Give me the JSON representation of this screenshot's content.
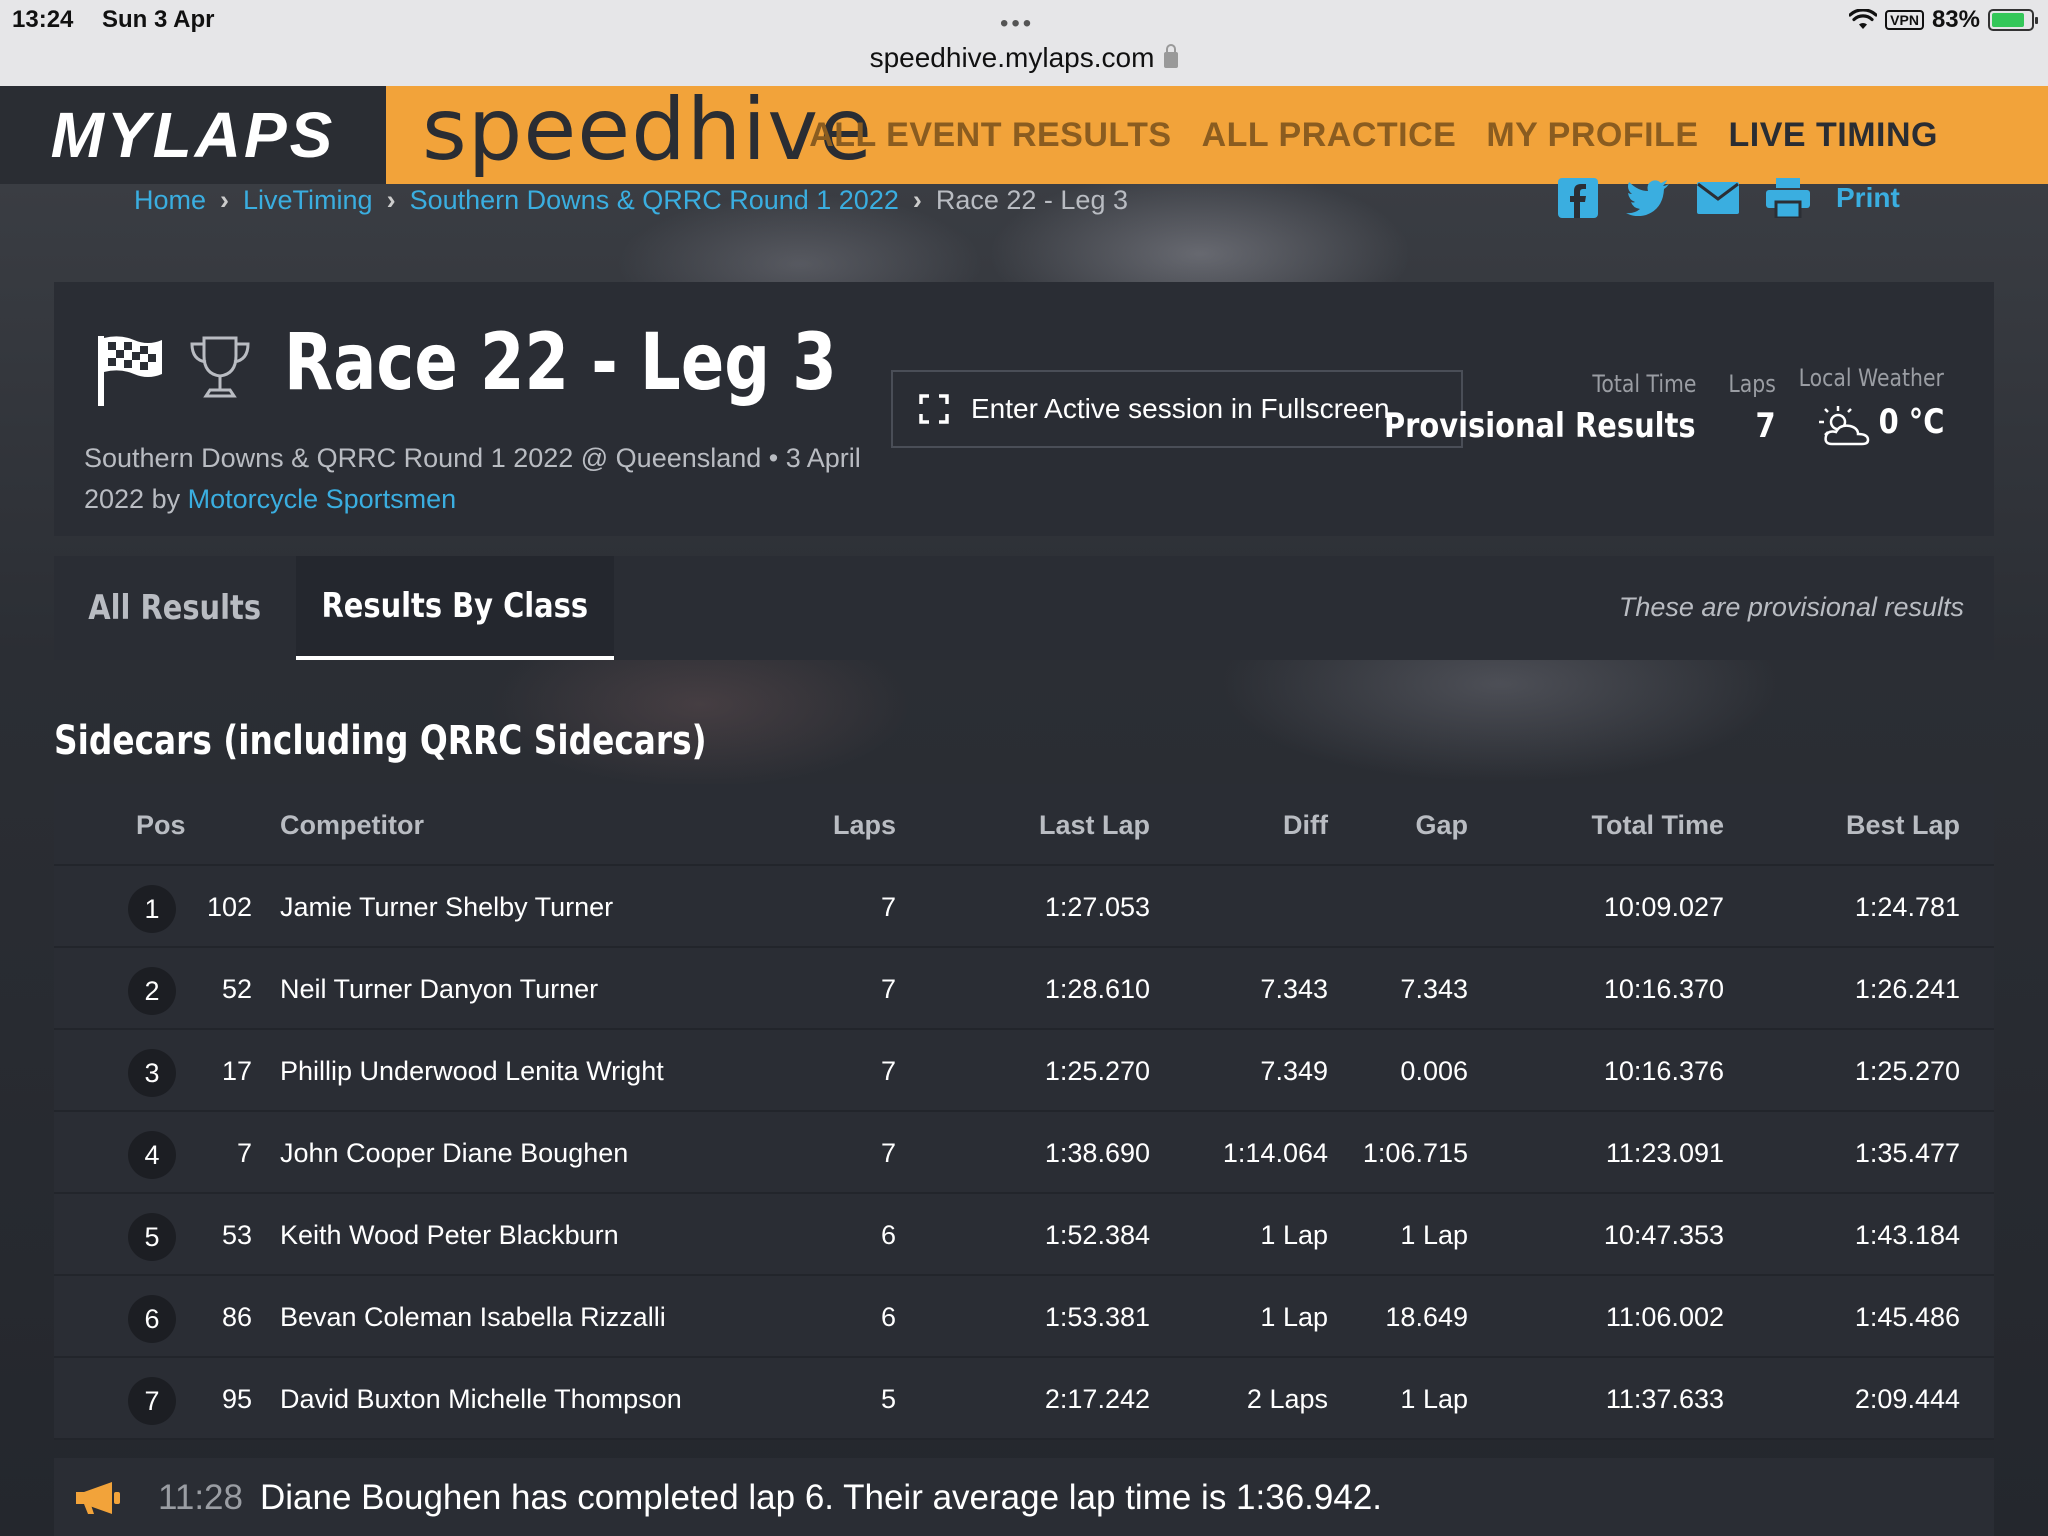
{
  "statusbar": {
    "time": "13:24",
    "date": "Sun 3 Apr",
    "url": "speedhive.mylaps.com",
    "vpn": "VPN",
    "battery": "83%",
    "battery_level": 0.83
  },
  "nav": {
    "brand": "MYLAPS",
    "logo": "speedhive",
    "links": [
      "ALL EVENT RESULTS",
      "ALL PRACTICE",
      "MY PROFILE",
      "LIVE TIMING"
    ],
    "active_index": 3
  },
  "breadcrumb": {
    "items": [
      "Home",
      "LiveTiming",
      "Southern Downs & QRRC Round 1 2022"
    ],
    "current": "Race 22 - Leg 3"
  },
  "share": {
    "icons": [
      "facebook-icon",
      "twitter-icon",
      "email-icon",
      "printer-icon"
    ],
    "print_label": "Print"
  },
  "race": {
    "title": "Race 22 - Leg 3",
    "subtitle": "Southern Downs & QRRC Round 1 2022 @ Queensland • 3 April 2022 by",
    "organizer": "Motorcycle Sportsmen",
    "fullscreen_label": "Enter Active session in Fullscreen",
    "stats": {
      "total_time_label": "Total Time",
      "total_time_value": "Provisional Results",
      "laps_label": "Laps",
      "laps_value": "7",
      "weather_label": "Local Weather",
      "weather_value": "0 °C",
      "weather_icon": "partly-cloudy-icon"
    }
  },
  "tabs": {
    "all": "All Results",
    "by_class": "Results By Class",
    "note": "These are provisional results"
  },
  "class_title": "Sidecars (including QRRC Sidecars)",
  "table": {
    "headers": {
      "pos": "Pos",
      "competitor": "Competitor",
      "laps": "Laps",
      "last_lap": "Last Lap",
      "diff": "Diff",
      "gap": "Gap",
      "total_time": "Total Time",
      "best_lap": "Best Lap"
    },
    "rows": [
      {
        "pos": "1",
        "num": "102",
        "competitor": "Jamie Turner Shelby Turner",
        "laps": "7",
        "last_lap": "1:27.053",
        "diff": "",
        "gap": "",
        "total_time": "10:09.027",
        "best_lap": "1:24.781"
      },
      {
        "pos": "2",
        "num": "52",
        "competitor": "Neil Turner Danyon Turner",
        "laps": "7",
        "last_lap": "1:28.610",
        "diff": "7.343",
        "gap": "7.343",
        "total_time": "10:16.370",
        "best_lap": "1:26.241"
      },
      {
        "pos": "3",
        "num": "17",
        "competitor": "Phillip Underwood Lenita Wright",
        "laps": "7",
        "last_lap": "1:25.270",
        "diff": "7.349",
        "gap": "0.006",
        "total_time": "10:16.376",
        "best_lap": "1:25.270"
      },
      {
        "pos": "4",
        "num": "7",
        "competitor": "John Cooper Diane Boughen",
        "laps": "7",
        "last_lap": "1:38.690",
        "diff": "1:14.064",
        "gap": "1:06.715",
        "total_time": "11:23.091",
        "best_lap": "1:35.477"
      },
      {
        "pos": "5",
        "num": "53",
        "competitor": "Keith Wood Peter Blackburn",
        "laps": "6",
        "last_lap": "1:52.384",
        "diff": "1 Lap",
        "gap": "1 Lap",
        "total_time": "10:47.353",
        "best_lap": "1:43.184"
      },
      {
        "pos": "6",
        "num": "86",
        "competitor": "Bevan Coleman Isabella Rizzalli",
        "laps": "6",
        "last_lap": "1:53.381",
        "diff": "1 Lap",
        "gap": "18.649",
        "total_time": "11:06.002",
        "best_lap": "1:45.486"
      },
      {
        "pos": "7",
        "num": "95",
        "competitor": "David Buxton Michelle Thompson",
        "laps": "5",
        "last_lap": "2:17.242",
        "diff": "2 Laps",
        "gap": "1 Lap",
        "total_time": "11:37.633",
        "best_lap": "2:09.444"
      }
    ]
  },
  "feed": {
    "time": "11:28",
    "message": "Diane Boughen has completed lap 6. Their average lap time is 1:36.942."
  },
  "colors": {
    "accent_orange": "#f2a33a",
    "link_blue": "#3aaee0",
    "card_bg": "#2a2d34",
    "page_bg": "#24272e"
  }
}
